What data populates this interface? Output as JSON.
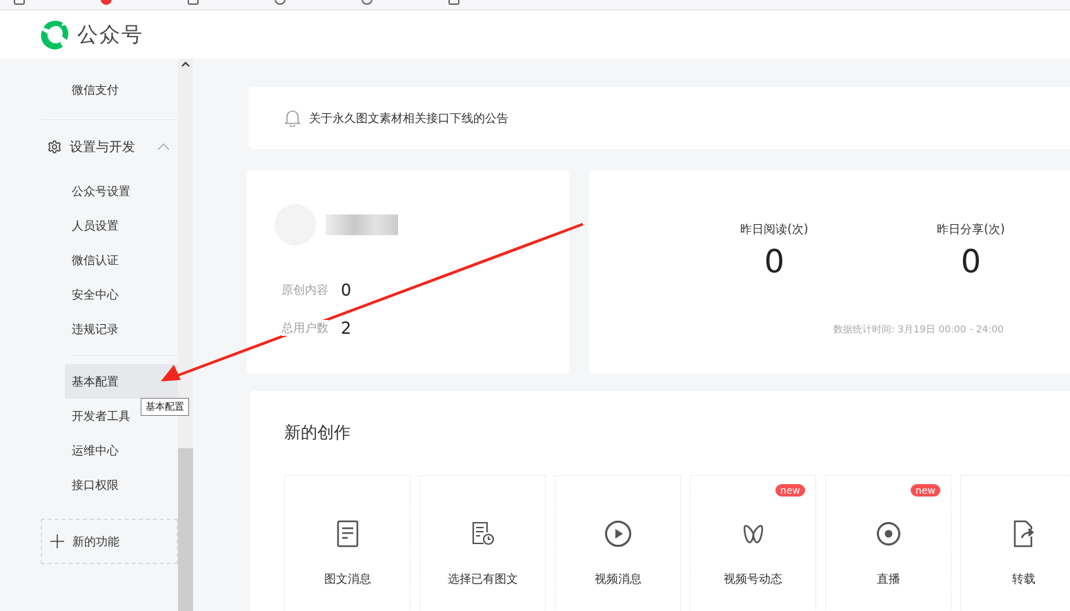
{
  "header": {
    "title": "公众号"
  },
  "sidebar": {
    "items": [
      {
        "label": "微信支付",
        "selected": false
      }
    ],
    "section": {
      "label": "设置与开发",
      "expanded": true,
      "groups": [
        [
          {
            "label": "公众号设置",
            "selected": false
          },
          {
            "label": "人员设置",
            "selected": false
          },
          {
            "label": "微信认证",
            "selected": false
          },
          {
            "label": "安全中心",
            "selected": false
          },
          {
            "label": "违规记录",
            "selected": false
          }
        ],
        [
          {
            "label": "基本配置",
            "selected": true
          },
          {
            "label": "开发者工具",
            "selected": false
          },
          {
            "label": "运维中心",
            "selected": false
          },
          {
            "label": "接口权限",
            "selected": false
          }
        ]
      ]
    },
    "new_feature": "新的功能"
  },
  "tooltip": "基本配置",
  "notice": "关于永久图文素材相关接口下线的公告",
  "account": {
    "stats": [
      {
        "label": "原创内容",
        "value": "0"
      },
      {
        "label": "总用户数",
        "value": "2"
      }
    ]
  },
  "metrics": [
    {
      "label": "昨日阅读(次)",
      "value": "0"
    },
    {
      "label": "昨日分享(次)",
      "value": "0"
    }
  ],
  "stats_time": "数据统计时间: 3月19日 00:00 - 24:00",
  "create": {
    "title": "新的创作",
    "items": [
      {
        "label": "图文消息",
        "kind": "article"
      },
      {
        "label": "选择已有图文",
        "kind": "existing"
      },
      {
        "label": "视频消息",
        "kind": "video"
      },
      {
        "label": "视频号动态",
        "kind": "channels",
        "badge": "new"
      },
      {
        "label": "直播",
        "kind": "live",
        "badge": "new"
      },
      {
        "label": "转载",
        "kind": "repost"
      }
    ]
  }
}
